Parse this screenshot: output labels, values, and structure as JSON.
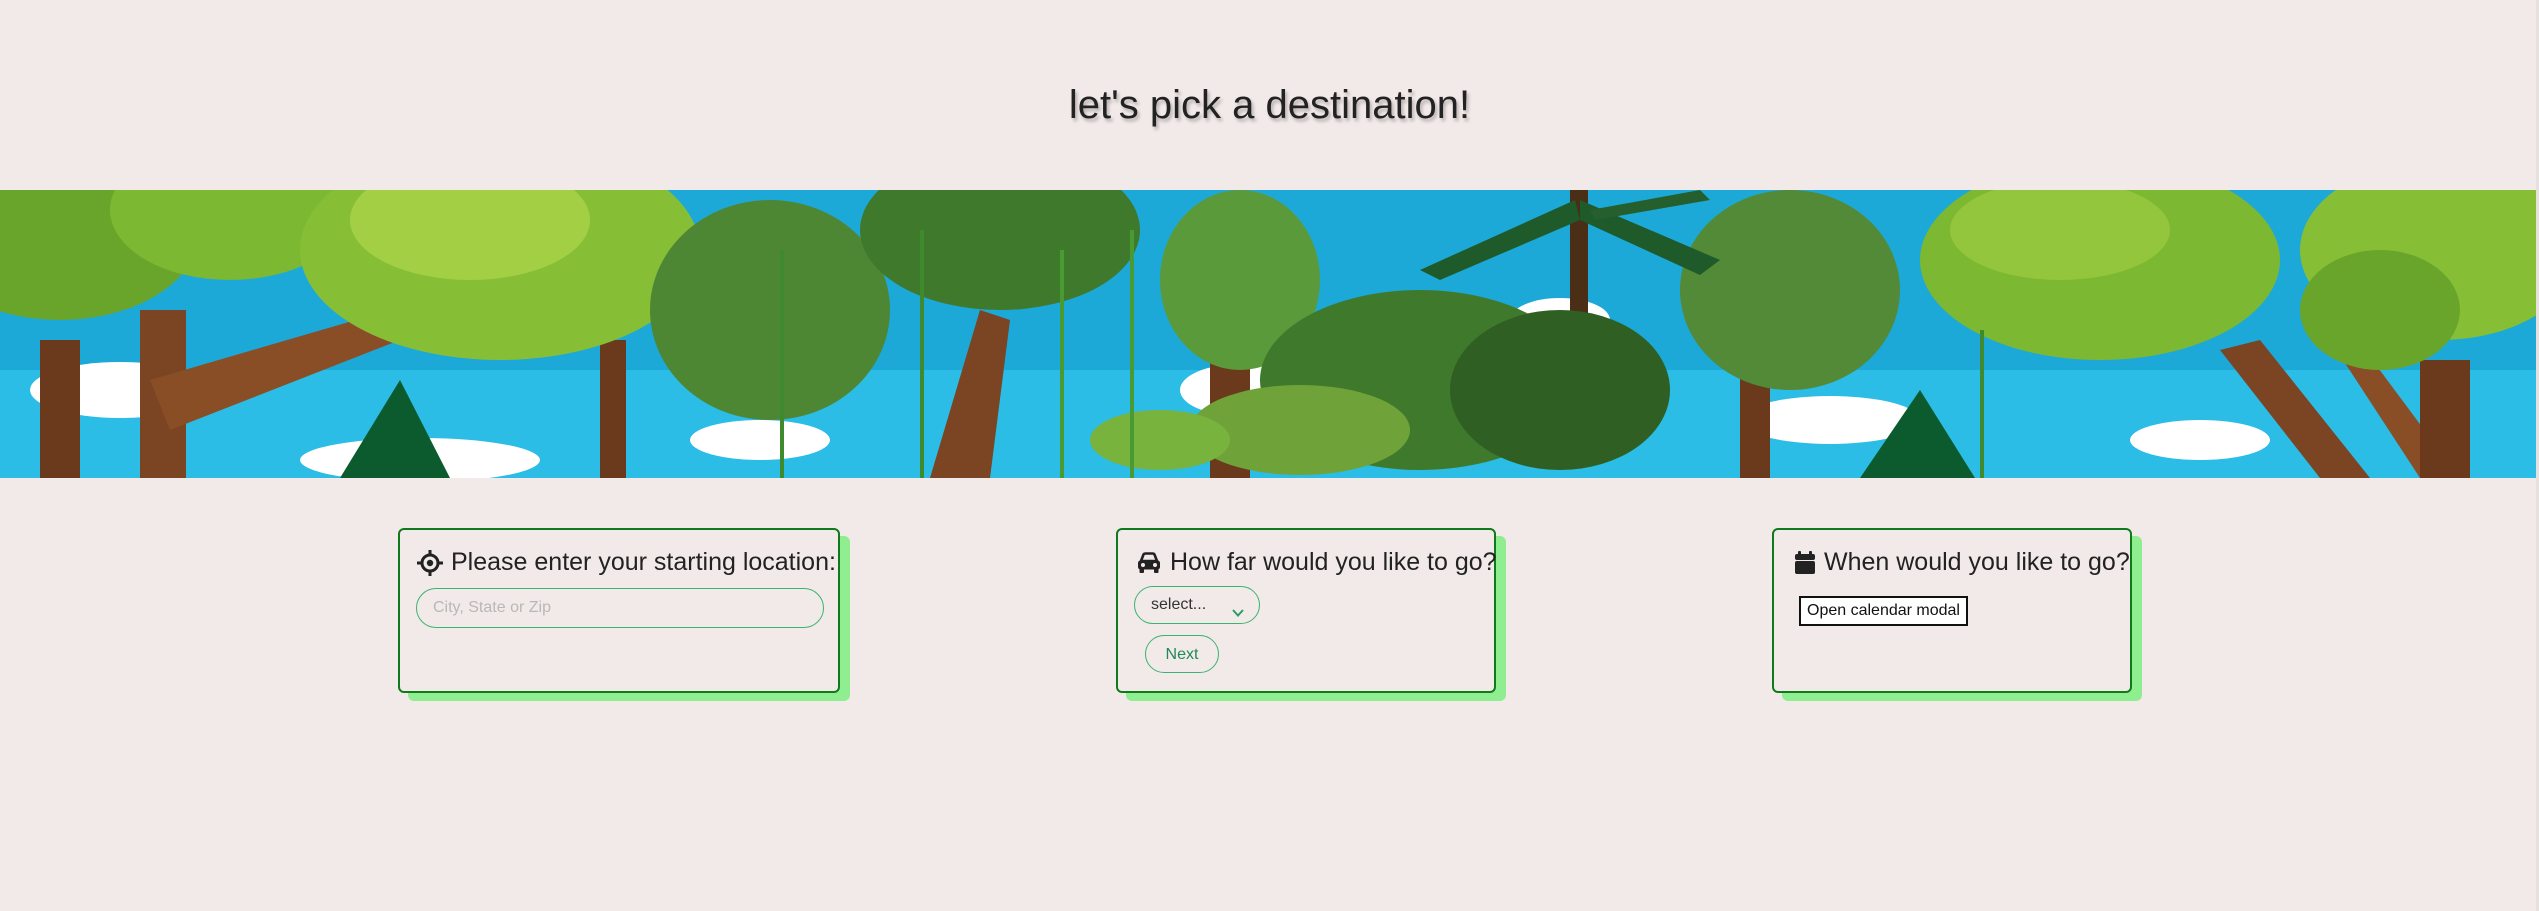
{
  "page": {
    "title": "let's pick a destination!",
    "background_color": "#f2eae8"
  },
  "banner": {
    "description_icon": "jungle-illustration"
  },
  "cards": {
    "location": {
      "icon": "crosshairs-icon",
      "title": "Please enter your starting location:",
      "input_placeholder": "City, State or Zip",
      "input_value": ""
    },
    "distance": {
      "icon": "car-icon",
      "title": "How far would you like to go?",
      "select_value": "select...",
      "next_label": "Next"
    },
    "date": {
      "icon": "calendar-icon",
      "title": "When would you like to go?",
      "button_label": "Open calendar modal"
    }
  },
  "colors": {
    "card_border": "#0e7a1b",
    "card_shadow": "#8fee8f",
    "input_border": "#3cb371"
  }
}
